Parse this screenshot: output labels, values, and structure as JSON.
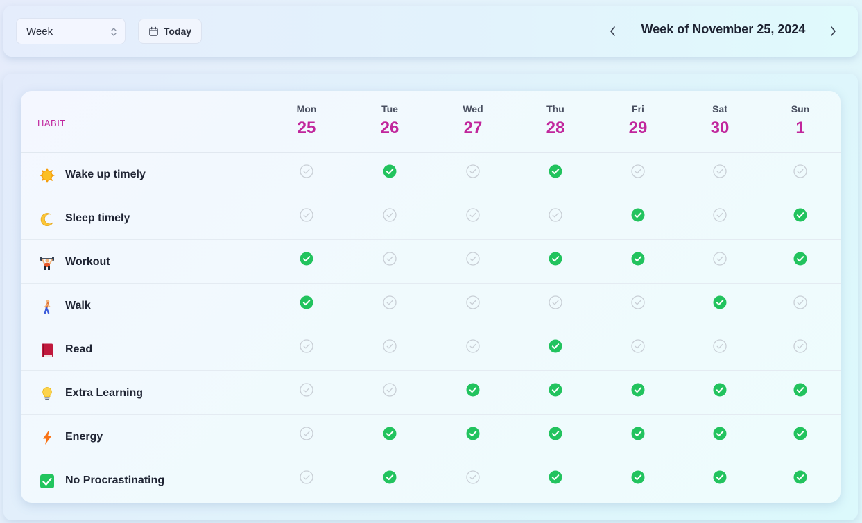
{
  "toolbar": {
    "view_select": {
      "value": "Week",
      "icon": "chevron-up-down-icon"
    },
    "today_button": {
      "label": "Today",
      "icon": "calendar-icon"
    },
    "prev_icon": "chevron-left-icon",
    "next_icon": "chevron-right-icon",
    "week_title": "Week of November 25, 2024"
  },
  "table": {
    "habit_header": "HABIT",
    "days": [
      {
        "dow": "Mon",
        "date": "25"
      },
      {
        "dow": "Tue",
        "date": "26"
      },
      {
        "dow": "Wed",
        "date": "27"
      },
      {
        "dow": "Thu",
        "date": "28"
      },
      {
        "dow": "Fri",
        "date": "29"
      },
      {
        "dow": "Sat",
        "date": "30"
      },
      {
        "dow": "Sun",
        "date": "1"
      }
    ],
    "habits": [
      {
        "name": "Wake up timely",
        "icon": "sun-icon",
        "checks": [
          false,
          true,
          false,
          true,
          false,
          false,
          false
        ]
      },
      {
        "name": "Sleep timely",
        "icon": "moon-icon",
        "checks": [
          false,
          false,
          false,
          false,
          true,
          false,
          true
        ]
      },
      {
        "name": "Workout",
        "icon": "weightlifter-icon",
        "checks": [
          true,
          false,
          false,
          true,
          true,
          false,
          true
        ]
      },
      {
        "name": "Walk",
        "icon": "walking-person-icon",
        "checks": [
          true,
          false,
          false,
          false,
          false,
          true,
          false
        ]
      },
      {
        "name": "Read",
        "icon": "book-icon",
        "checks": [
          false,
          false,
          false,
          true,
          false,
          false,
          false
        ]
      },
      {
        "name": "Extra Learning",
        "icon": "lightbulb-icon",
        "checks": [
          false,
          false,
          true,
          true,
          true,
          true,
          true
        ]
      },
      {
        "name": "Energy",
        "icon": "lightning-icon",
        "checks": [
          false,
          true,
          true,
          true,
          true,
          true,
          true
        ]
      },
      {
        "name": "No Procrastinating",
        "icon": "checkbox-icon",
        "checks": [
          false,
          true,
          false,
          true,
          true,
          true,
          true
        ]
      }
    ]
  },
  "colors": {
    "accent": "#c1269c",
    "checked": "#22c35e",
    "unchecked": "#c9cfd6"
  }
}
